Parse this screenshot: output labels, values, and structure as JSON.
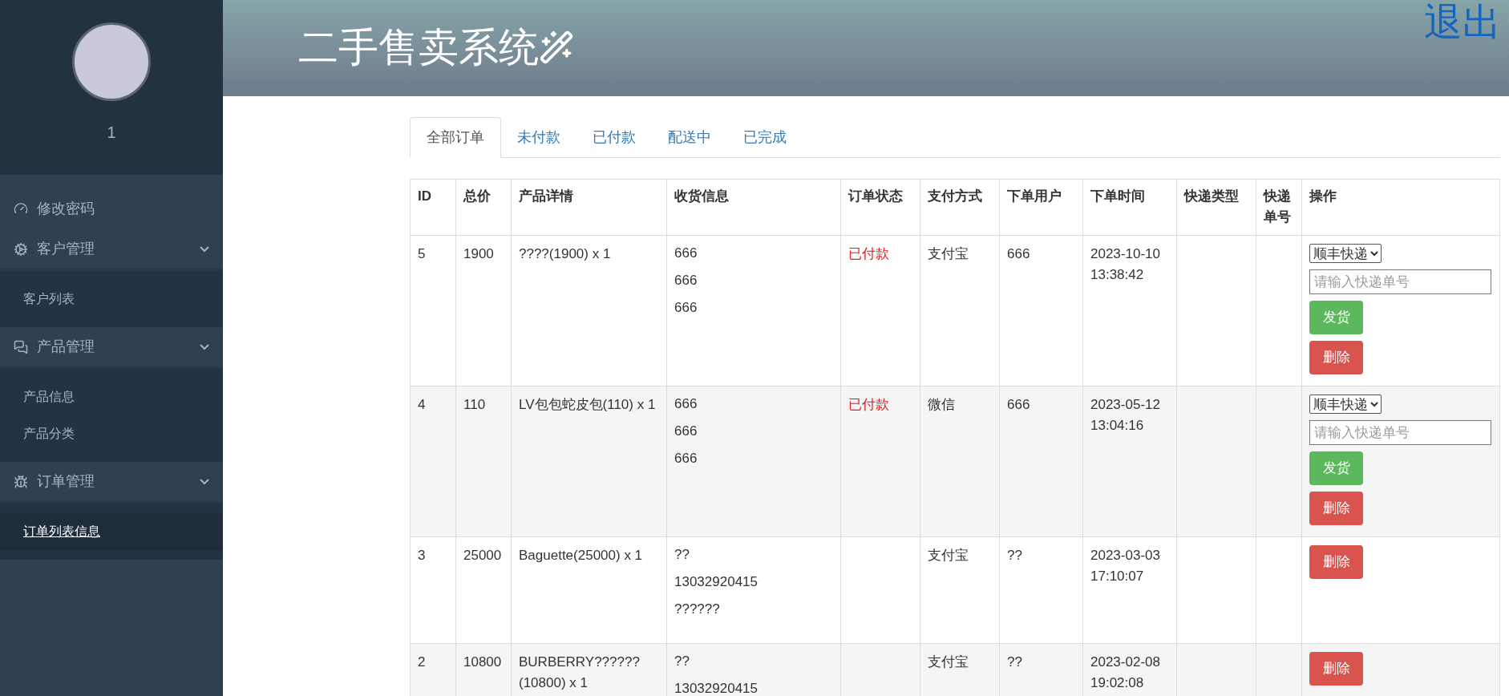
{
  "sidebar": {
    "user_name": "1",
    "menu": [
      {
        "label": "修改密码"
      },
      {
        "label": "客户管理",
        "expanded": true,
        "children": [
          {
            "label": "客户列表",
            "selected": false
          }
        ]
      },
      {
        "label": "产品管理",
        "expanded": true,
        "children": [
          {
            "label": "产品信息",
            "selected": false
          },
          {
            "label": "产品分类",
            "selected": false
          }
        ]
      },
      {
        "label": "订单管理",
        "expanded": true,
        "children": [
          {
            "label": "订单列表信息",
            "selected": true
          }
        ]
      }
    ]
  },
  "header": {
    "title": "二手售卖系统",
    "logout": "退出"
  },
  "tabs": [
    {
      "label": "全部订单",
      "selected": true
    },
    {
      "label": "未付款",
      "selected": false
    },
    {
      "label": "已付款",
      "selected": false
    },
    {
      "label": "配送中",
      "selected": false
    },
    {
      "label": "已完成",
      "selected": false
    }
  ],
  "table": {
    "columns": [
      "ID",
      "总价",
      "产品详情",
      "收货信息",
      "订单状态",
      "支付方式",
      "下单用户",
      "下单时间",
      "快递类型",
      "快递单号",
      "操作"
    ],
    "rows": [
      {
        "id": "5",
        "total": "1900",
        "product": "????(1900) x 1",
        "shipping": [
          "666",
          "666",
          "666"
        ],
        "status": "已付款",
        "payment": "支付宝",
        "user": "666",
        "time": "2023-10-10 13:38:42",
        "actions": {
          "courier": "顺丰快递",
          "tracking_placeholder": "请输入快递单号",
          "ship": "发货",
          "delete": "删除"
        }
      },
      {
        "id": "4",
        "total": "110",
        "product": "LV包包蛇皮包(110) x 1",
        "shipping": [
          "666",
          "666",
          "666"
        ],
        "status": "已付款",
        "payment": "微信",
        "user": "666",
        "time": "2023-05-12 13:04:16",
        "actions": {
          "courier": "顺丰快递",
          "tracking_placeholder": "请输入快递单号",
          "ship": "发货",
          "delete": "删除"
        }
      },
      {
        "id": "3",
        "total": "25000",
        "product": "Baguette(25000) x 1",
        "shipping": [
          "??",
          "13032920415",
          "??????"
        ],
        "payment": "支付宝",
        "user": "??",
        "time": "2023-03-03 17:10:07",
        "actions": {
          "delete": "删除"
        }
      },
      {
        "id": "2",
        "total": "10800",
        "product": "BURBERRY?????? (10800) x 1",
        "shipping": [
          "??",
          "13032920415"
        ],
        "payment": "支付宝",
        "user": "??",
        "time": "2023-02-08 19:02:08",
        "actions": {
          "delete": "删除"
        }
      }
    ]
  }
}
